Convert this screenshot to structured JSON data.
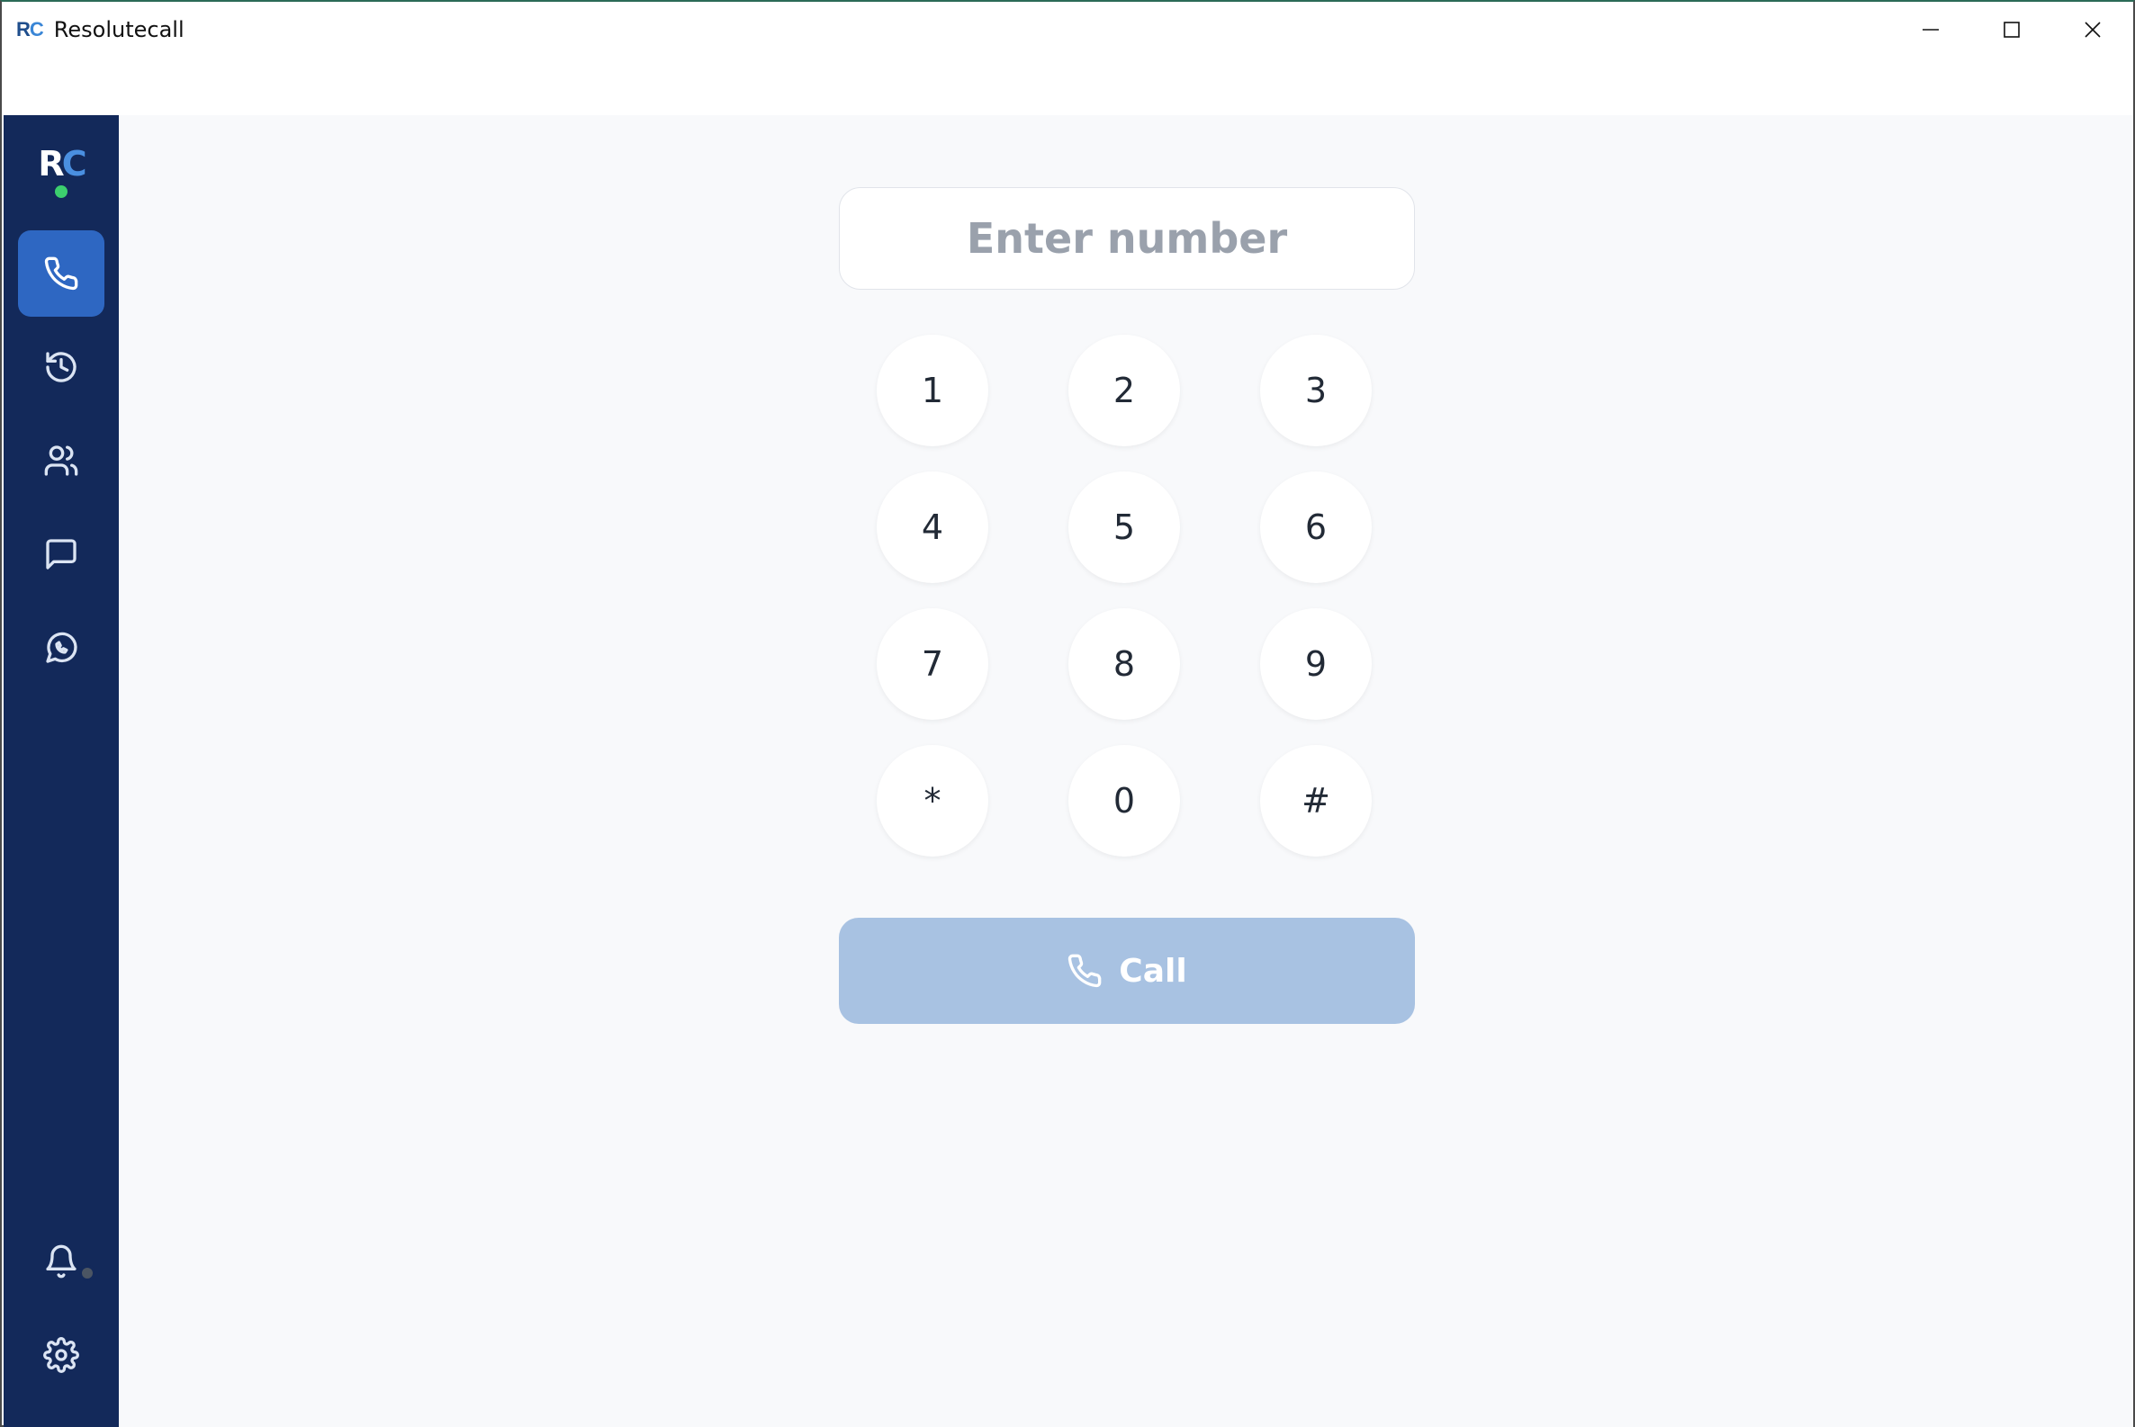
{
  "window": {
    "app_mark_r": "R",
    "app_mark_c": "C",
    "title": "Resolutecall"
  },
  "sidebar": {
    "logo_r": "R",
    "logo_c": "C",
    "items": [
      {
        "name": "phone",
        "icon": "phone-icon",
        "active": true
      },
      {
        "name": "history",
        "icon": "history-icon",
        "active": false
      },
      {
        "name": "contacts",
        "icon": "users-icon",
        "active": false
      },
      {
        "name": "messages",
        "icon": "message-icon",
        "active": false
      },
      {
        "name": "whatsapp",
        "icon": "whatsapp-icon",
        "active": false
      }
    ],
    "bottom_items": [
      {
        "name": "notifications",
        "icon": "bell-icon"
      },
      {
        "name": "settings",
        "icon": "gear-icon"
      }
    ]
  },
  "dialer": {
    "placeholder": "Enter number",
    "value": "",
    "keys": [
      "1",
      "2",
      "3",
      "4",
      "5",
      "6",
      "7",
      "8",
      "9",
      "*",
      "0",
      "#"
    ],
    "call_label": "Call"
  },
  "colors": {
    "sidebar_bg": "#13295a",
    "active_item": "#2e67c2",
    "call_button": "#a8c2e2",
    "main_bg": "#f8f9fb",
    "online_dot": "#3ccf6e"
  }
}
